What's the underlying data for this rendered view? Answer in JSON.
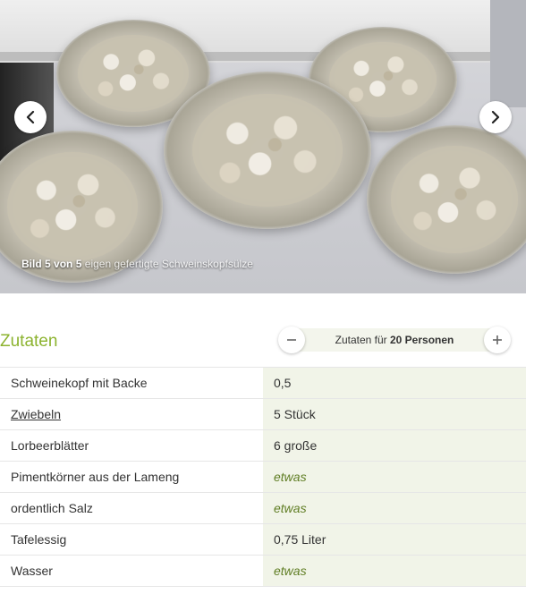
{
  "gallery": {
    "caption_prefix": "Bild",
    "caption_current": "5",
    "caption_of": "von",
    "caption_total": "5",
    "caption_text": "eigen gefertigte Schweinskopfsülze",
    "prev_icon": "chevron-left-icon",
    "next_icon": "chevron-right-icon"
  },
  "ingredients": {
    "title": "Zutaten",
    "servings_prefix": "Zutaten für",
    "servings_value": "20 Personen",
    "minus_icon": "minus-icon",
    "plus_icon": "plus-icon",
    "accent_color": "#8cb32f",
    "items": [
      {
        "name": "Schweinekopf mit Backe",
        "amount": "0,5"
      },
      {
        "name": "Zwiebeln",
        "amount": "5 Stück"
      },
      {
        "name": "Lorbeerblätter",
        "amount": "6 große"
      },
      {
        "name": "Pimentkörner aus der Lameng",
        "amount": "etwas"
      },
      {
        "name": "ordentlich Salz",
        "amount": "etwas"
      },
      {
        "name": "Tafelessig",
        "amount": "0,75 Liter"
      },
      {
        "name": "Wasser",
        "amount": "etwas"
      }
    ]
  }
}
